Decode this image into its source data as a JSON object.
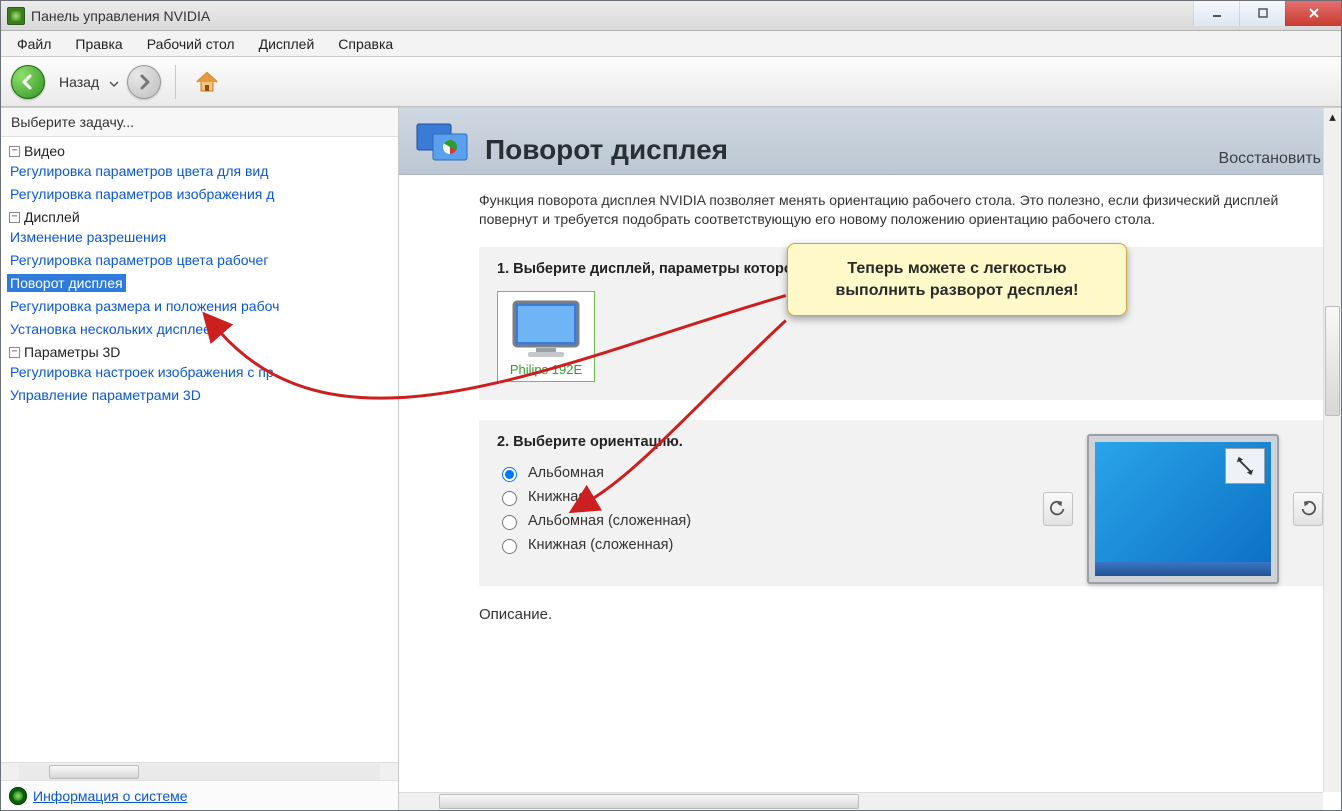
{
  "window": {
    "title": "Панель управления NVIDIA"
  },
  "menu": {
    "items": [
      "Файл",
      "Правка",
      "Рабочий стол",
      "Дисплей",
      "Справка"
    ]
  },
  "toolbar": {
    "back_label": "Назад"
  },
  "sidebar": {
    "title": "Выберите задачу...",
    "groups": [
      {
        "label": "Видео",
        "items": [
          "Регулировка параметров цвета для вид",
          "Регулировка параметров изображения д"
        ]
      },
      {
        "label": "Дисплей",
        "items": [
          "Изменение разрешения",
          "Регулировка параметров цвета рабочег",
          "Поворот дисплея",
          "Регулировка размера и положения рабоч",
          "Установка нескольких дисплеев"
        ],
        "selected_index": 2
      },
      {
        "label": "Параметры 3D",
        "items": [
          "Регулировка настроек изображения с пр",
          "Управление параметрами 3D"
        ]
      }
    ],
    "footer_link": "Информация о системе"
  },
  "content": {
    "title": "Поворот дисплея",
    "restore": "Восстановить",
    "description": "Функция поворота дисплея NVIDIA позволяет менять ориентацию рабочего стола. Это полезно, если физический дисплей повернут и требуется подобрать соответствующую его новому положению ориентацию рабочего стола.",
    "step1_title": "1. Выберите дисплей, параметры которого требуется изменить.",
    "display_name": "Philips 192E",
    "step2_title": "2. Выберите ориентацию.",
    "orientation_options": [
      "Альбомная",
      "Книжная",
      "Альбомная (сложенная)",
      "Книжная (сложенная)"
    ],
    "selected_orientation_index": 0,
    "desc2": "Описание."
  },
  "callout": {
    "text": "Теперь можете с легкостью выполнить разворот десплея!"
  }
}
